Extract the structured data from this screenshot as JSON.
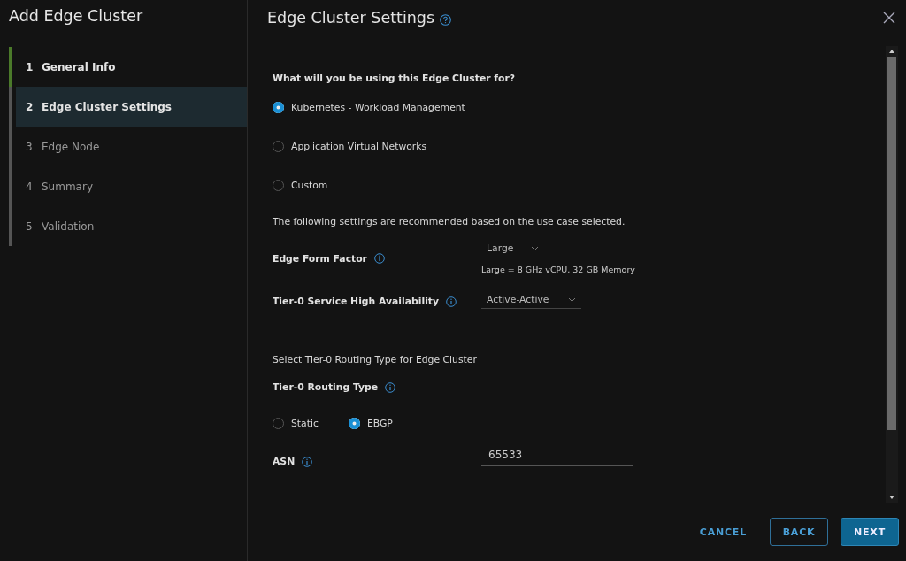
{
  "sidebar": {
    "title": "Add Edge Cluster",
    "steps": [
      {
        "number": "1",
        "label": "General Info",
        "completed": true,
        "selected": false
      },
      {
        "number": "2",
        "label": "Edge Cluster Settings",
        "completed": false,
        "selected": true
      },
      {
        "number": "3",
        "label": "Edge Node",
        "completed": false,
        "selected": false
      },
      {
        "number": "4",
        "label": "Summary",
        "completed": false,
        "selected": false
      },
      {
        "number": "5",
        "label": "Validation",
        "completed": false,
        "selected": false
      }
    ]
  },
  "panel": {
    "title": "Edge Cluster Settings",
    "use_case": {
      "question": "What will you be using this Edge Cluster for?",
      "options": [
        {
          "label": "Kubernetes - Workload Management",
          "selected": true
        },
        {
          "label": "Application Virtual Networks",
          "selected": false
        },
        {
          "label": "Custom",
          "selected": false
        }
      ]
    },
    "recommendation_note": "The following settings are recommended based on the use case selected.",
    "edge_form_factor": {
      "label": "Edge Form Factor",
      "value": "Large",
      "hint": "Large = 8 GHz vCPU, 32 GB Memory"
    },
    "high_availability": {
      "label": "Tier-0 Service High Availability",
      "value": "Active-Active"
    },
    "routing_note": "Select Tier-0 Routing Type for Edge Cluster",
    "routing_type": {
      "label": "Tier-0 Routing Type",
      "options": [
        {
          "label": "Static",
          "selected": false
        },
        {
          "label": "EBGP",
          "selected": true
        }
      ]
    },
    "asn": {
      "label": "ASN",
      "value": "65533"
    }
  },
  "buttons": [
    {
      "label": "CANCEL",
      "kind": "link"
    },
    {
      "label": "BACK",
      "kind": "outline"
    },
    {
      "label": "NEXT",
      "kind": "primary"
    }
  ]
}
